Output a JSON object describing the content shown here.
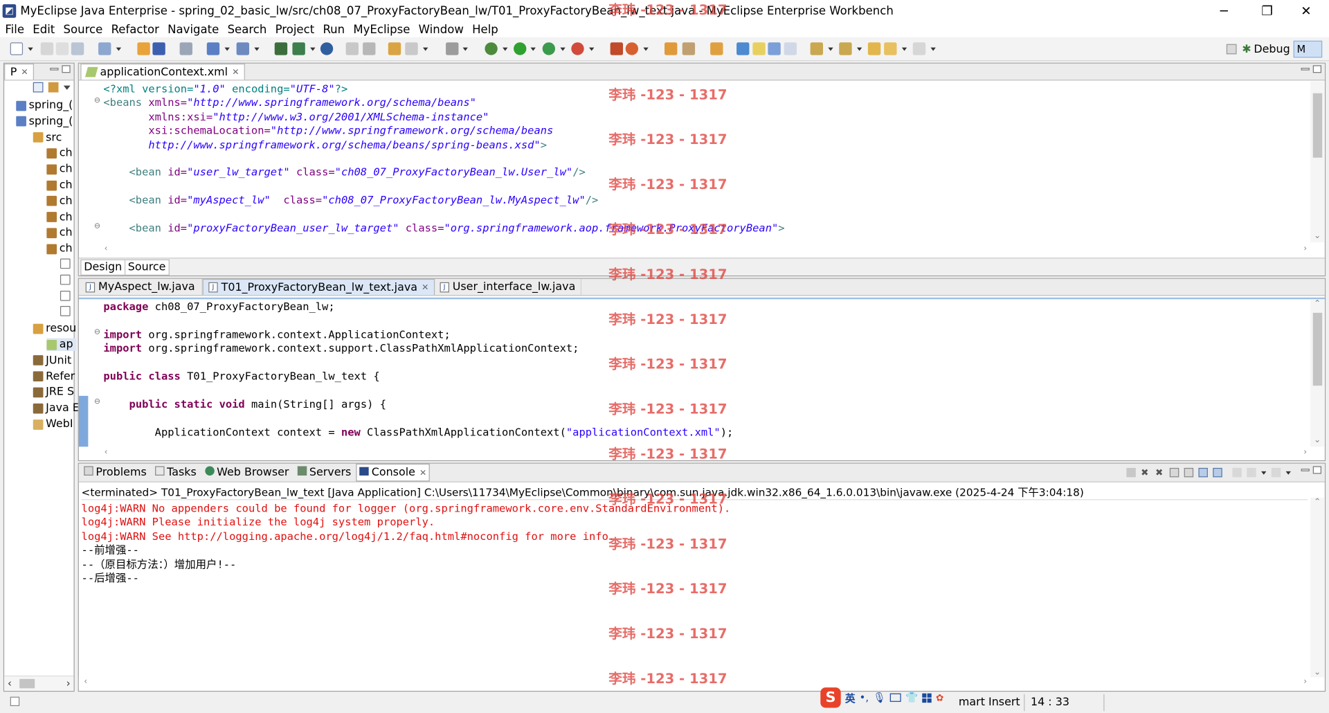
{
  "window": {
    "title": "MyEclipse Java Enterprise - spring_02_basic_lw/src/ch08_07_ProxyFactoryBean_lw/T01_ProxyFactoryBean_lw_text.java - MyEclipse Enterprise Workbench",
    "minimize": "─",
    "restore": "❐",
    "close": "✕"
  },
  "menu": [
    "File",
    "Edit",
    "Source",
    "Refactor",
    "Navigate",
    "Search",
    "Project",
    "Run",
    "MyEclipse",
    "Window",
    "Help"
  ],
  "toolbar": {
    "debug_label": "Debug",
    "active_perspective": "M"
  },
  "explorer": {
    "tab_label": "P",
    "items": [
      {
        "label": "spring_(",
        "kind": "project"
      },
      {
        "label": "spring_(",
        "kind": "project"
      },
      {
        "label": "src",
        "kind": "folder"
      },
      {
        "label": "ch",
        "kind": "package"
      },
      {
        "label": "ch",
        "kind": "package"
      },
      {
        "label": "ch",
        "kind": "package"
      },
      {
        "label": "ch",
        "kind": "package"
      },
      {
        "label": "ch",
        "kind": "package"
      },
      {
        "label": "ch",
        "kind": "package"
      },
      {
        "label": "ch",
        "kind": "package"
      },
      {
        "label": "",
        "kind": "file"
      },
      {
        "label": "",
        "kind": "file"
      },
      {
        "label": "",
        "kind": "file"
      },
      {
        "label": "",
        "kind": "file"
      },
      {
        "label": "resou",
        "kind": "folder"
      },
      {
        "label": "ap",
        "kind": "xml"
      },
      {
        "label": "JUnit",
        "kind": "lib"
      },
      {
        "label": "Refer",
        "kind": "lib"
      },
      {
        "label": "JRE S",
        "kind": "lib"
      },
      {
        "label": "Java E",
        "kind": "lib"
      },
      {
        "label": "WebI",
        "kind": "webfolder"
      }
    ]
  },
  "xml_editor": {
    "tab_label": "applicationContext.xml",
    "lines": [
      [
        {
          "t": "<?xml version=",
          "c": "xml-decl"
        },
        {
          "t": "\"1.0\"",
          "c": "xml-val"
        },
        {
          "t": " encoding=",
          "c": "xml-decl"
        },
        {
          "t": "\"UTF-8\"",
          "c": "xml-val"
        },
        {
          "t": "?>",
          "c": "xml-decl"
        }
      ],
      [
        {
          "t": "<beans ",
          "c": "xml-tag"
        },
        {
          "t": "xmlns=",
          "c": "xml-attr"
        },
        {
          "t": "\"http://www.springframework.org/schema/beans\"",
          "c": "xml-val"
        }
      ],
      [
        {
          "t": "       xmlns:xsi=",
          "c": "xml-attr"
        },
        {
          "t": "\"http://www.w3.org/2001/XMLSchema-instance\"",
          "c": "xml-val"
        }
      ],
      [
        {
          "t": "       xsi:schemaLocation=",
          "c": "xml-attr"
        },
        {
          "t": "\"http://www.springframework.org/schema/beans",
          "c": "xml-val"
        }
      ],
      [
        {
          "t": "       http://www.springframework.org/schema/beans/spring-beans.xsd\"",
          "c": "xml-val"
        },
        {
          "t": ">",
          "c": "xml-tag"
        }
      ],
      [],
      [
        {
          "t": "    <bean ",
          "c": "xml-tag"
        },
        {
          "t": "id=",
          "c": "xml-attr"
        },
        {
          "t": "\"user_lw_target\"",
          "c": "xml-val"
        },
        {
          "t": " class=",
          "c": "xml-attr"
        },
        {
          "t": "\"ch08_07_ProxyFactoryBean_lw.User_lw\"",
          "c": "xml-val"
        },
        {
          "t": "/>",
          "c": "xml-tag"
        }
      ],
      [],
      [
        {
          "t": "    <bean ",
          "c": "xml-tag"
        },
        {
          "t": "id=",
          "c": "xml-attr"
        },
        {
          "t": "\"myAspect_lw\"",
          "c": "xml-val"
        },
        {
          "t": "  class=",
          "c": "xml-attr"
        },
        {
          "t": "\"ch08_07_ProxyFactoryBean_lw.MyAspect_lw\"",
          "c": "xml-val"
        },
        {
          "t": "/>",
          "c": "xml-tag"
        }
      ],
      [],
      [
        {
          "t": "    <bean ",
          "c": "xml-tag"
        },
        {
          "t": "id=",
          "c": "xml-attr"
        },
        {
          "t": "\"proxyFactoryBean_user_lw_target\"",
          "c": "xml-val"
        },
        {
          "t": " class=",
          "c": "xml-attr"
        },
        {
          "t": "\"org.springframework.aop.framework.ProxyFactoryBean\"",
          "c": "xml-val"
        },
        {
          "t": ">",
          "c": "xml-tag"
        }
      ]
    ],
    "design_tab": "Design",
    "source_tab": "Source"
  },
  "java_editor": {
    "tabs": [
      "MyAspect_lw.java",
      "T01_ProxyFactoryBean_lw_text.java",
      "User_interface_lw.java"
    ],
    "lines": [
      [
        {
          "t": "package",
          "c": "kw"
        },
        {
          "t": " ch08_07_ProxyFactoryBean_lw;",
          "c": "plain"
        }
      ],
      [],
      [
        {
          "t": "import",
          "c": "kw"
        },
        {
          "t": " org.springframework.context.ApplicationContext;",
          "c": "plain"
        }
      ],
      [
        {
          "t": "import",
          "c": "kw"
        },
        {
          "t": " org.springframework.context.support.ClassPathXmlApplicationContext;",
          "c": "plain"
        }
      ],
      [],
      [
        {
          "t": "public",
          "c": "kw"
        },
        {
          "t": " ",
          "c": "plain"
        },
        {
          "t": "class",
          "c": "kw"
        },
        {
          "t": " T01_ProxyFactoryBean_lw_text {",
          "c": "plain"
        }
      ],
      [],
      [
        {
          "t": "    ",
          "c": "plain"
        },
        {
          "t": "public",
          "c": "kw"
        },
        {
          "t": " ",
          "c": "plain"
        },
        {
          "t": "static",
          "c": "kw"
        },
        {
          "t": " ",
          "c": "plain"
        },
        {
          "t": "void",
          "c": "kw"
        },
        {
          "t": " main(String[] args) {",
          "c": "plain"
        }
      ],
      [],
      [
        {
          "t": "        ApplicationContext context = ",
          "c": "plain"
        },
        {
          "t": "new",
          "c": "kw"
        },
        {
          "t": " ClassPathXmlApplicationContext(",
          "c": "plain"
        },
        {
          "t": "\"applicationContext.xml\"",
          "c": "str"
        },
        {
          "t": ");",
          "c": "plain"
        }
      ]
    ]
  },
  "bottom_panel": {
    "tabs": [
      "Problems",
      "Tasks",
      "Web Browser",
      "Servers",
      "Console"
    ],
    "terminated": "<terminated> T01_ProxyFactoryBean_lw_text [Java Application] C:\\Users\\11734\\MyEclipse\\Common\\binary\\com.sun.java.jdk.win32.x86_64_1.6.0.013\\bin\\javaw.exe (2025-4-24 下午3:04:18)",
    "console_lines": [
      {
        "t": "log4j:WARN No appenders could be found for logger (org.springframework.core.env.StandardEnvironment).",
        "c": "warn"
      },
      {
        "t": "log4j:WARN Please initialize the log4j system properly.",
        "c": "warn"
      },
      {
        "t": "log4j:WARN See http://logging.apache.org/log4j/1.2/faq.html#noconfig for more info.",
        "c": "warn"
      },
      {
        "t": "--前增强--",
        "c": "out"
      },
      {
        "t": "--（原目标方法：）增加用户!--",
        "c": "out"
      },
      {
        "t": "--后增强--",
        "c": "out"
      }
    ]
  },
  "status": {
    "mode": "mart Insert",
    "position": "14 : 33",
    "ime_lang": "英"
  },
  "watermark": "李玮 -123 - 1317",
  "colors": {
    "keyword": "#7f0055",
    "string": "#2a00ff",
    "warn": "#e01010",
    "watermark": "#e0453f"
  }
}
